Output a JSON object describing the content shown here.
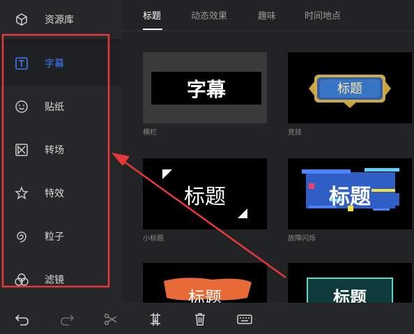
{
  "sidebar": {
    "library_label": "资源库",
    "items": [
      {
        "label": "字幕",
        "icon": "text-t-icon"
      },
      {
        "label": "贴纸",
        "icon": "smiley-icon"
      },
      {
        "label": "转场",
        "icon": "transition-icon"
      },
      {
        "label": "特效",
        "icon": "star-icon"
      },
      {
        "label": "粒子",
        "icon": "swirl-icon"
      },
      {
        "label": "滤镜",
        "icon": "circles-icon"
      }
    ]
  },
  "tabs": [
    "标题",
    "动态效果",
    "趣味",
    "时间地点"
  ],
  "cards": [
    {
      "text": "字幕",
      "label": "横栏"
    },
    {
      "text": "标题",
      "label": "竞技"
    },
    {
      "text": "标题",
      "label": "小标题"
    },
    {
      "text": "标题",
      "label": "故障闪烁"
    },
    {
      "text": "标题",
      "label": ""
    },
    {
      "text": "标题",
      "label": ""
    }
  ],
  "colors": {
    "accent": "#3d7bff",
    "annotation": "#e8383b"
  }
}
